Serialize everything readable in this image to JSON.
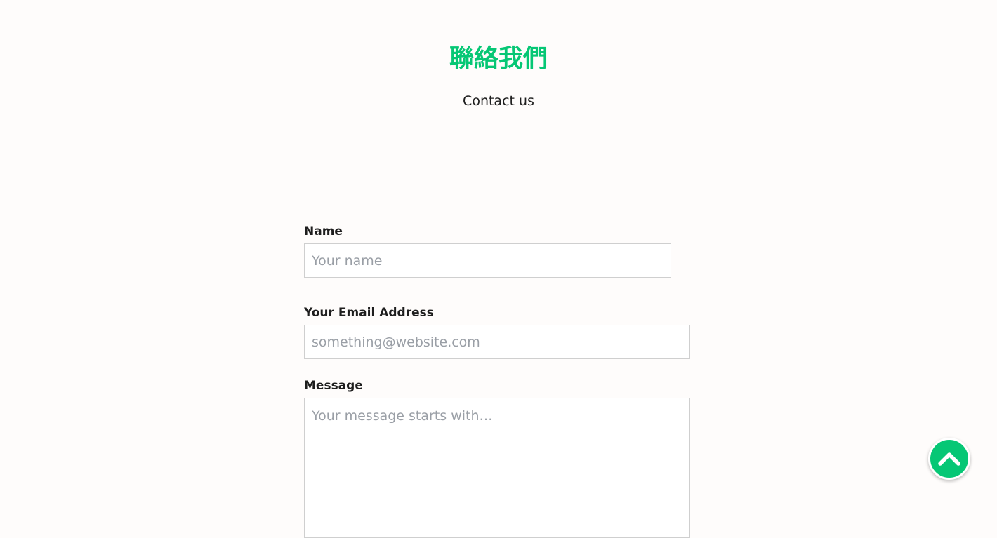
{
  "header": {
    "title": "聯絡我們",
    "subtitle": "Contact us"
  },
  "form": {
    "name": {
      "label": "Name",
      "placeholder": "Your name",
      "value": ""
    },
    "email": {
      "label": "Your Email Address",
      "placeholder": "something@website.com",
      "value": ""
    },
    "message": {
      "label": "Message",
      "placeholder": "Your message starts with…",
      "value": ""
    }
  },
  "scroll_top": {
    "icon": "chevron-up-icon"
  },
  "colors": {
    "accent": "#06c775",
    "background": "#fefcfb",
    "text": "#1e1e1e",
    "placeholder": "#9a9fa6",
    "border": "#cfcfcf"
  }
}
